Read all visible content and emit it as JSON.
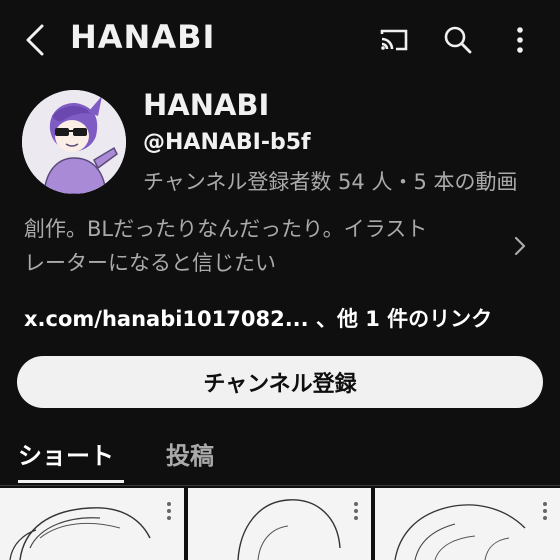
{
  "header": {
    "title": "HANABI",
    "icons": [
      "back-icon",
      "cast-icon",
      "search-icon",
      "more-vert-icon"
    ]
  },
  "channel": {
    "name": "HANABI",
    "handle": "@HANABI-b5f",
    "stats": "チャンネル登録者数 54 人・5 本の動画",
    "description_line1": "創作。BLだったりなんだったり。イラスト",
    "description_line2": "レーターになると信じたい",
    "link_text": "x.com/hanabi1017082...",
    "more_links": "、他 1 件のリンク",
    "subscribe_label": "チャンネル登録"
  },
  "tabs": [
    {
      "label": "ショート",
      "selected": true
    },
    {
      "label": "投稿",
      "selected": false
    }
  ],
  "colors": {
    "background": "#0f0f0f",
    "text_primary": "#f1f1f1",
    "text_secondary": "#aaaaaa",
    "button_bg": "#f1f1f1"
  }
}
